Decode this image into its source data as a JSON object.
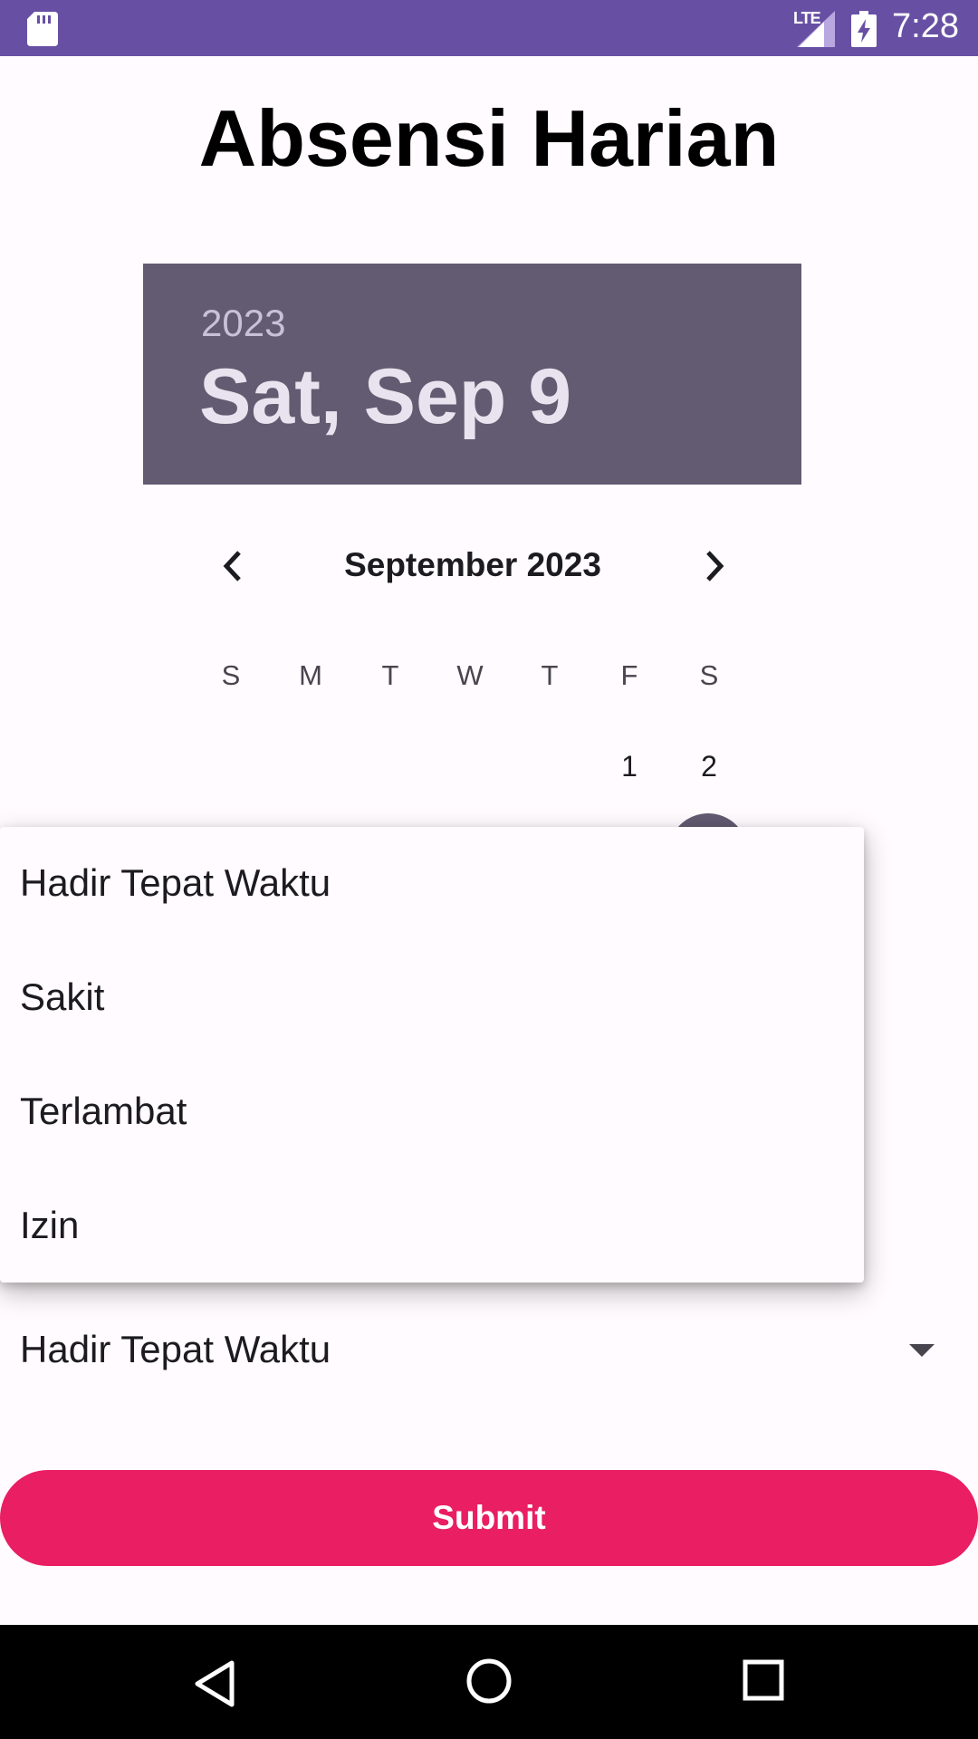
{
  "status_bar": {
    "network": "LTE",
    "time": "7:28",
    "icons": [
      "sd-card-icon",
      "signal-icon",
      "battery-charging-icon"
    ]
  },
  "page": {
    "title": "Absensi Harian"
  },
  "date_picker": {
    "year": "2023",
    "selected_date": "Sat, Sep 9",
    "month_label": "September 2023",
    "weekdays": [
      "S",
      "M",
      "T",
      "W",
      "T",
      "F",
      "S"
    ],
    "first_row_days": [
      "1",
      "2"
    ],
    "selected_day": "9",
    "accent_color": "#625b71"
  },
  "spinner": {
    "selected": "Hadir Tepat Waktu",
    "options": [
      "Hadir Tepat Waktu",
      "Sakit",
      "Terlambat",
      "Izin"
    ]
  },
  "submit": {
    "label": "Submit",
    "color": "#e91e63"
  },
  "nav_bar": {
    "icons": [
      "back-icon",
      "home-icon",
      "recents-icon"
    ]
  }
}
